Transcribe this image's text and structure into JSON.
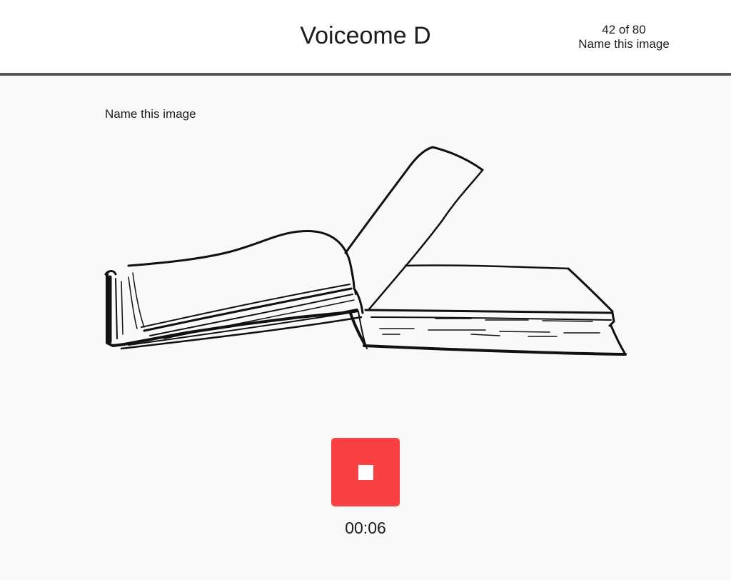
{
  "header": {
    "title": "Voiceome D",
    "progress_count": "42 of 80",
    "progress_task": "Name this image"
  },
  "task": {
    "prompt": "Name this image",
    "image_subject": "open-book-drawing"
  },
  "recorder": {
    "state": "recording",
    "elapsed": "00:06",
    "button_color": "#f94144",
    "icon": "stop-icon"
  }
}
